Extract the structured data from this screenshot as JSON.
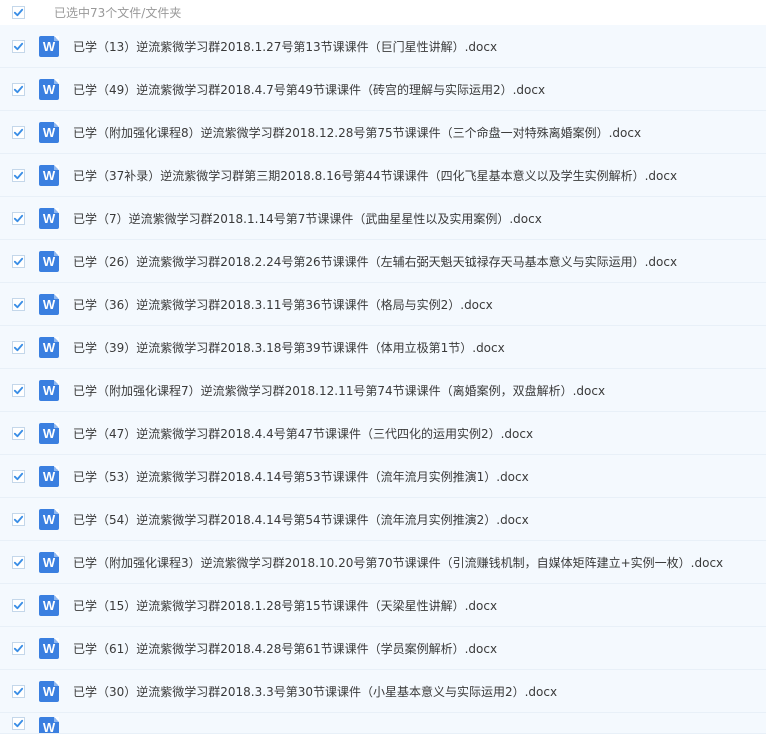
{
  "header": {
    "label": "已选中73个文件/文件夹",
    "checked": true
  },
  "colors": {
    "row_bg": "#f4f9fe",
    "check": "#3a8ee6",
    "word_icon": "#3a7fe0"
  },
  "icon": {
    "file_type": "word-doc-icon",
    "glyph": "W"
  },
  "files": [
    {
      "name": "已学（13）逆流紫微学习群2018.1.27号第13节课课件（巨门星性讲解）.docx",
      "checked": true
    },
    {
      "name": "已学（49）逆流紫微学习群2018.4.7号第49节课课件（砖宫的理解与实际运用2）.docx",
      "checked": true
    },
    {
      "name": "已学（附加强化课程8）逆流紫微学习群2018.12.28号第75节课课件（三个命盘一对特殊离婚案例）.docx",
      "checked": true
    },
    {
      "name": "已学（37补录）逆流紫微学习群第三期2018.8.16号第44节课课件（四化飞星基本意义以及学生实例解析）.docx",
      "checked": true
    },
    {
      "name": "已学（7）逆流紫微学习群2018.1.14号第7节课课件（武曲星星性以及实用案例）.docx",
      "checked": true
    },
    {
      "name": "已学（26）逆流紫微学习群2018.2.24号第26节课课件（左辅右弼天魁天钺禄存天马基本意义与实际运用）.docx",
      "checked": true
    },
    {
      "name": "已学（36）逆流紫微学习群2018.3.11号第36节课课件（格局与实例2）.docx",
      "checked": true
    },
    {
      "name": "已学（39）逆流紫微学习群2018.3.18号第39节课课件（体用立极第1节）.docx",
      "checked": true
    },
    {
      "name": "已学（附加强化课程7）逆流紫微学习群2018.12.11号第74节课课件（离婚案例，双盘解析）.docx",
      "checked": true
    },
    {
      "name": "已学（47）逆流紫微学习群2018.4.4号第47节课课件（三代四化的运用实例2）.docx",
      "checked": true
    },
    {
      "name": "已学（53）逆流紫微学习群2018.4.14号第53节课课件（流年流月实例推演1）.docx",
      "checked": true
    },
    {
      "name": "已学（54）逆流紫微学习群2018.4.14号第54节课课件（流年流月实例推演2）.docx",
      "checked": true
    },
    {
      "name": "已学（附加强化课程3）逆流紫微学习群2018.10.20号第70节课课件（引流赚钱机制，自媒体矩阵建立+实例一枚）.docx",
      "checked": true
    },
    {
      "name": "已学（15）逆流紫微学习群2018.1.28号第15节课课件（天梁星性讲解）.docx",
      "checked": true
    },
    {
      "name": "已学（61）逆流紫微学习群2018.4.28号第61节课课件（学员案例解析）.docx",
      "checked": true
    },
    {
      "name": "已学（30）逆流紫微学习群2018.3.3号第30节课课件（小星基本意义与实际运用2）.docx",
      "checked": true
    }
  ]
}
